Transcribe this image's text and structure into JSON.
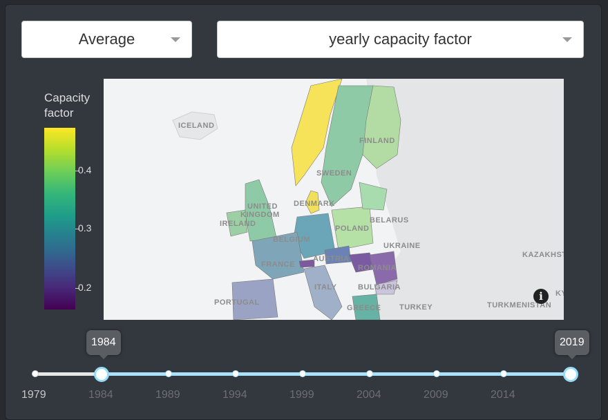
{
  "controls": {
    "statistic": "Average",
    "variable": "yearly capacity factor"
  },
  "colorbar": {
    "title_line1": "Capacity",
    "title_line2": "factor",
    "ticks": [
      "0.4",
      "0.3",
      "0.2"
    ],
    "colorscale": "viridis"
  },
  "map": {
    "labels": {
      "iceland": "ICELAND",
      "finland": "FINLAND",
      "sweden": "SWEDEN",
      "denmark": "DENMARK",
      "united": "UNITED",
      "kingdom": "KINGDOM",
      "ireland": "IRELAND",
      "belarus": "BELARUS",
      "poland": "POLAND",
      "belgium": "BELGIUM",
      "ukraine": "UKRAINE",
      "kazakhstan": "KAZAKHST",
      "france": "FRANCE",
      "austria": "AUSTRIA",
      "romania": "ROMANIA",
      "italy": "ITALY",
      "bulgaria": "BULGARIA",
      "portugal": "PORTUGAL",
      "greece": "GREECE",
      "turkey": "TURKEY",
      "turkmenistan": "TURKMENISTAN",
      "kyrgyz": "KY"
    },
    "info_glyph": "i"
  },
  "slider": {
    "start_value": "1984",
    "end_value": "2019",
    "marks": [
      "1979",
      "1984",
      "1989",
      "1994",
      "1999",
      "2004",
      "2009",
      "2014"
    ]
  }
}
